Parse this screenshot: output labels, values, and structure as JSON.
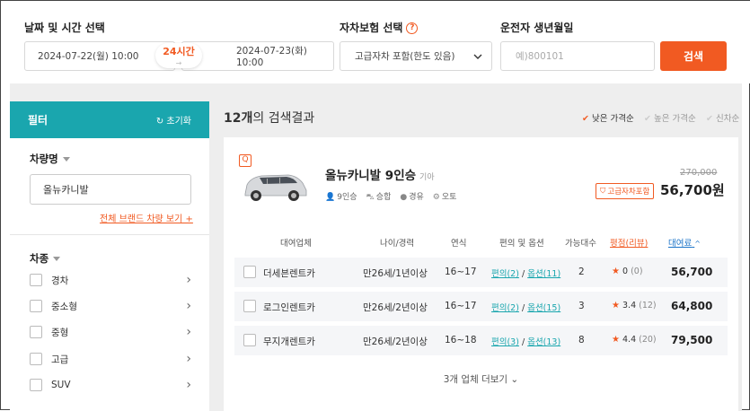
{
  "search": {
    "datetime_label": "날짜 및 시간 선택",
    "start": "2024-07-22(월) 10:00",
    "end": "2024-07-23(화) 10:00",
    "duration": "24시간",
    "duration_arrow": "→",
    "insurance_label": "자차보험 선택",
    "insurance_help": "?",
    "insurance_value": "고급자차 포함(한도 있음)",
    "birth_label": "운전자 생년월일",
    "birth_placeholder": "예)800101",
    "search_button": "검색"
  },
  "filter": {
    "title": "필터",
    "reset": "초기화",
    "car_name_label": "차량명",
    "car_name_value": "올뉴카니발",
    "brand_link": "전체 브랜드 차량 보기 +",
    "car_type_label": "차종",
    "car_types": [
      "경차",
      "중소형",
      "중형",
      "고급",
      "SUV"
    ]
  },
  "results": {
    "count": "12개",
    "suffix": "의 검색결과",
    "sort": [
      "낮은 가격순",
      "높은 가격순",
      "신차순"
    ],
    "sort_active": "낮은 가격순"
  },
  "car": {
    "name": "올뉴카니발 9인승",
    "maker": "기아",
    "specs": [
      {
        "icon": "person-icon",
        "glyph": "👤",
        "text": "9인승"
      },
      {
        "icon": "car-icon",
        "glyph": "⛍",
        "text": "승합"
      },
      {
        "icon": "fuel-icon",
        "glyph": "●",
        "text": "경유"
      },
      {
        "icon": "gear-icon",
        "glyph": "⚙",
        "text": "오토"
      }
    ],
    "old_price": "270,000",
    "insurance_badge": "고급자차포함",
    "price": "56,700원"
  },
  "table": {
    "headers": [
      "대여업체",
      "나이/경력",
      "연식",
      "편의 및 옵션",
      "가능대수",
      "평점(리뷰)",
      "대여료"
    ],
    "sort_caret": "^",
    "rows": [
      {
        "company": "더세븐렌트카",
        "age": "만26세/1년이상",
        "year": "16~17",
        "conv": "편의(2)",
        "sep": "/",
        "opt": "옵션(11)",
        "count": "2",
        "rating": "0",
        "reviews": "(0)",
        "fee": "56,700"
      },
      {
        "company": "로그인렌트카",
        "age": "만26세/2년이상",
        "year": "16~17",
        "conv": "편의(2)",
        "sep": "/",
        "opt": "옵션(15)",
        "count": "3",
        "rating": "3.4",
        "reviews": "(12)",
        "fee": "64,800"
      },
      {
        "company": "무지개렌트카",
        "age": "만26세/2년이상",
        "year": "16~18",
        "conv": "편의(3)",
        "sep": "/",
        "opt": "옵션(13)",
        "count": "8",
        "rating": "4.4",
        "reviews": "(20)",
        "fee": "79,500"
      }
    ],
    "more": "3개 업체 더보기"
  },
  "colors": {
    "accent": "#f15a22",
    "teal": "#1aa6ae"
  }
}
